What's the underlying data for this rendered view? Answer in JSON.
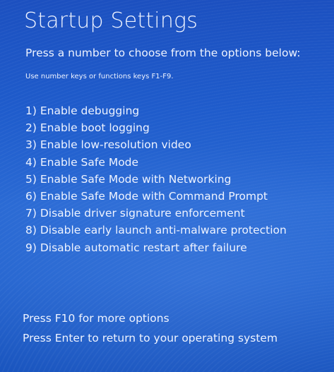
{
  "screen": {
    "title": "Startup Settings",
    "prompt": "Press a number to choose from the options below:",
    "hint": "Use number keys or functions keys F1-F9.",
    "options": [
      {
        "label": "1) Enable debugging"
      },
      {
        "label": "2) Enable boot logging"
      },
      {
        "label": "3) Enable low-resolution video"
      },
      {
        "label": "4) Enable Safe Mode"
      },
      {
        "label": "5) Enable Safe Mode with Networking"
      },
      {
        "label": "6) Enable Safe Mode with Command Prompt"
      },
      {
        "label": "7) Disable driver signature enforcement"
      },
      {
        "label": "8) Disable early launch anti-malware protection"
      },
      {
        "label": "9) Disable automatic restart after failure"
      }
    ],
    "footer": {
      "more_options": "Press F10 for more options",
      "return": "Press Enter to return to your operating system"
    }
  },
  "colors": {
    "background": "#1f5ccc",
    "text": "#eef3ff"
  }
}
